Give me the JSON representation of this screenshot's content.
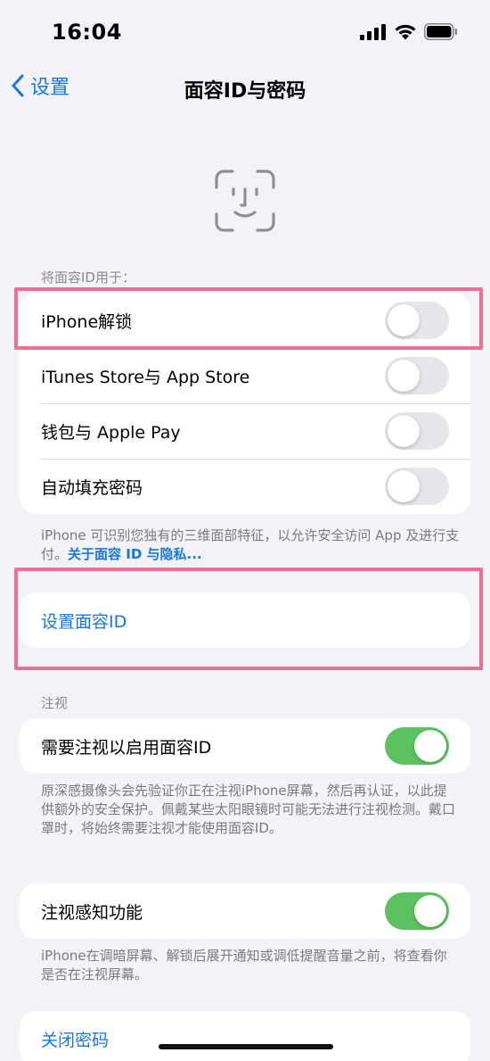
{
  "status_bar": {
    "time": "16:04"
  },
  "nav": {
    "back_label": "设置",
    "title": "面容ID与密码"
  },
  "faceid_section": {
    "header": "将面容ID用于：",
    "items": [
      {
        "label": "iPhone解锁",
        "on": false
      },
      {
        "label": "iTunes Store与 App Store",
        "on": false
      },
      {
        "label": "钱包与 Apple Pay",
        "on": false
      },
      {
        "label": "自动填充密码",
        "on": false
      }
    ],
    "footer_text": "iPhone 可识别您独有的三维面部特征，以允许安全访问 App 及进行支付。",
    "footer_link": "关于面容 ID 与隐私..."
  },
  "setup": {
    "label": "设置面容ID"
  },
  "attention_section": {
    "header": "注视",
    "item": {
      "label": "需要注视以启用面容ID",
      "on": true
    },
    "footer": "原深感摄像头会先验证你正在注视iPhone屏幕，然后再认证，以此提供额外的安全保护。佩戴某些太阳眼镜时可能无法进行注视检测。戴口罩时，将始终需要注视才能使用面容ID。"
  },
  "aware_section": {
    "item": {
      "label": "注视感知功能",
      "on": true
    },
    "footer": "iPhone在调暗屏幕、解锁后展开通知或调低提醒音量之前，将查看你是否在注视屏幕。"
  },
  "passcode": {
    "label": "关闭密码"
  },
  "colors": {
    "accent": "#1677e6",
    "toggle_on": "#5cc25f",
    "highlight": "#ee6f93",
    "background": "#f2f2f7"
  }
}
